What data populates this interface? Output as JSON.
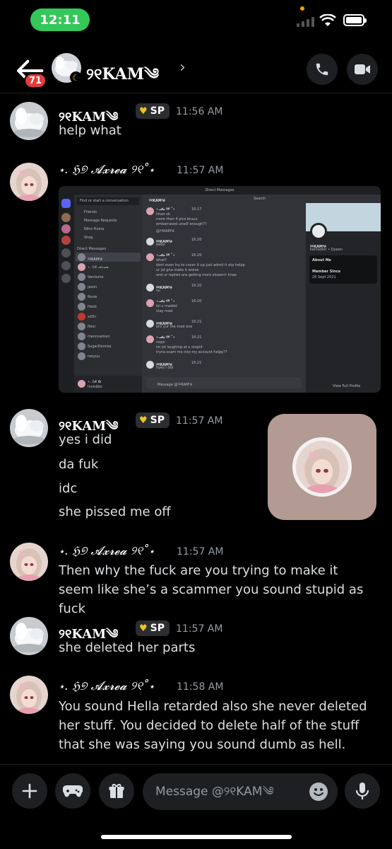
{
  "status_bar": {
    "time": "12:11"
  },
  "header": {
    "unread_count": "71",
    "name": "୨୧KAM༄"
  },
  "messages": [
    {
      "author": "୨୧KAM༄",
      "tag": "SP",
      "timestamp": "11:56 AM",
      "lines": [
        "help what"
      ]
    },
    {
      "author": "⋆. ℌ୭ 𝓐𝔁𝓻𝓮𝓪 ୨୧˚⋆",
      "timestamp": "11:57 AM",
      "attachment": "screenshot"
    },
    {
      "author": "୨୧KAM༄",
      "tag": "SP",
      "timestamp": "11:57 AM",
      "lines": [
        "yes i did",
        "da fuk",
        "idc",
        "she pissed me off"
      ]
    },
    {
      "author": "⋆. ℌ୭ 𝓐𝔁𝓻𝓮𝓪 ୨୧˚⋆",
      "timestamp": "11:57 AM",
      "lines": [
        "Then why the fuck are you trying to make it seem like she’s a scammer you sound stupid as fuck"
      ]
    },
    {
      "author": "୨୧KAM༄",
      "tag": "SP",
      "timestamp": "11:57 AM",
      "lines": [
        "she deleted her parts"
      ]
    },
    {
      "author": "⋆. ℌ୭ 𝓐𝔁𝓻𝓮𝓪 ୨୧˚⋆",
      "timestamp": "11:58 AM",
      "lines": [
        "You sound Hella retarded also she never deleted her stuff. You decided to delete half of the stuff that she was saying you sound dumb as hell."
      ]
    }
  ],
  "screenshot": {
    "title": "Direct Messages",
    "search": "Search",
    "find": "Find or start a conversation",
    "nav": [
      "Friends",
      "Message Requests",
      "Nitro Home",
      "Shop"
    ],
    "dm_header": "Direct Messages",
    "dm_names": [
      "୨୧KAM༄",
      "⋆. ℌ୭ 𝓐𝔁𝓻𝓮𝓪",
      "Vaniisme",
      "jason",
      "Rosie",
      "Heidi",
      "sd3n",
      "fleur",
      "mennnemen",
      "SugarDemise",
      "reeyuu"
    ],
    "self_name": "⋆. ℌ୭ ✿",
    "self_status": "Invisible",
    "chat_lines": [
      [
        "⋆.𝓐𝔁 ୨୧ ˚⋆",
        "16:17",
        "lmao ok",
        "more than 4 pics bruuu",
        "embarrased urself enough??",
        "@୨୧KAM༄"
      ],
      [
        "୨୧KAM༄",
        "16:20",
        "bebe"
      ],
      [
        "⋆.𝓐𝔁 ୨୧ ˚⋆",
        "16:20",
        "what?",
        "dont even try to cover it up just admit it atp helpp",
        "ur jst gna make it worse",
        "and ur replies are getting more slowerrr lmao"
      ],
      [
        "୨୧KAM༄",
        "16:20",
        "su"
      ],
      [
        "⋆.𝓐𝔁 ୨୧ ˚⋆",
        "16:20",
        "lol u maddd",
        "stay mad"
      ],
      [
        "୨୧KAM༄",
        "16:21",
        "bro yur the mad one"
      ],
      [
        "⋆.𝓐𝔁 ୨୧ ˚⋆",
        "16:21",
        "nope",
        "im jst laughing at u stupid",
        "tryna scam me into my account helpp??"
      ],
      [
        "୨୧KAM༄",
        "16:21",
        "hyes i did"
      ]
    ],
    "composer": "Message @୨୧KAM༄",
    "profile_name": "୨୧KAM༄",
    "profile_sub": "kamadior • Queen",
    "about_label": "About Me",
    "since_label": "Member Since",
    "since_date": "26 Sept 2021",
    "full_profile": "View Full Profile"
  },
  "composer": {
    "placeholder": "Message @୨୧KAM༄"
  },
  "colors": {
    "accent": "#5865f2",
    "status_green": "#34c759",
    "badge_red": "#e53b3b",
    "tag_heart": "#f0c419"
  }
}
